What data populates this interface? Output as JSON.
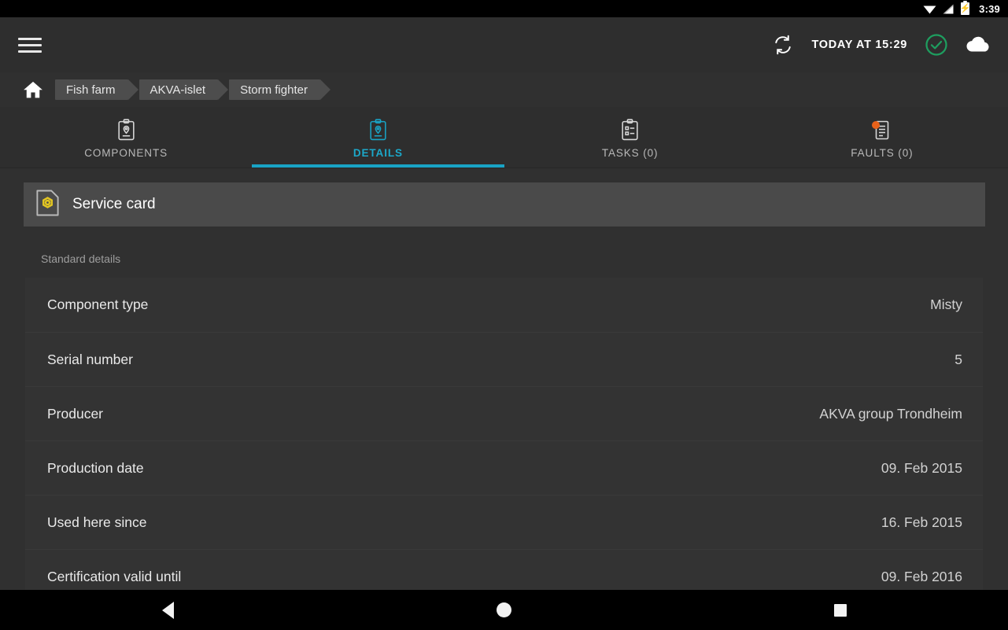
{
  "status_bar": {
    "time": "3:39",
    "icons": [
      "wifi-icon",
      "signal-icon",
      "battery-charging-icon"
    ]
  },
  "toolbar": {
    "menu_icon": "hamburger-menu-icon",
    "sync_icon": "sync-refresh-icon",
    "sync_text": "TODAY AT 15:29",
    "status_icon": "check-circle-icon",
    "status_color": "#1e9e5f",
    "cloud_icon": "cloud-icon"
  },
  "breadcrumb": {
    "home_icon": "home-icon",
    "items": [
      {
        "label": "Fish farm"
      },
      {
        "label": "AKVA-islet"
      },
      {
        "label": "Storm fighter"
      }
    ]
  },
  "tabs": {
    "active_color": "#19a3c5",
    "items": [
      {
        "label": "COMPONENTS",
        "icon": "clipboard-pin-icon",
        "active": false,
        "badge": false
      },
      {
        "label": "DETAILS",
        "icon": "clipboard-pin-icon",
        "active": true,
        "badge": false
      },
      {
        "label": "TASKS (0)",
        "icon": "clipboard-list-icon",
        "active": false,
        "badge": false
      },
      {
        "label": "FAULTS (0)",
        "icon": "document-lines-icon",
        "active": false,
        "badge": true,
        "badge_color": "#e8621a"
      }
    ]
  },
  "main": {
    "service_card": {
      "label": "Service card",
      "icon": "service-card-document-icon",
      "icon_accent": "#e2c522"
    },
    "section_title": "Standard details",
    "details": [
      {
        "key": "Component type",
        "value": "Misty"
      },
      {
        "key": "Serial number",
        "value": "5"
      },
      {
        "key": "Producer",
        "value": "AKVA group Trondheim"
      },
      {
        "key": "Production date",
        "value": "09. Feb 2015"
      },
      {
        "key": "Used here since",
        "value": "16. Feb 2015"
      },
      {
        "key": "Certification valid until",
        "value": "09. Feb 2016"
      }
    ]
  },
  "nav_bar": {
    "back": "back-triangle-icon",
    "home": "home-circle-icon",
    "recents": "recents-square-icon"
  }
}
